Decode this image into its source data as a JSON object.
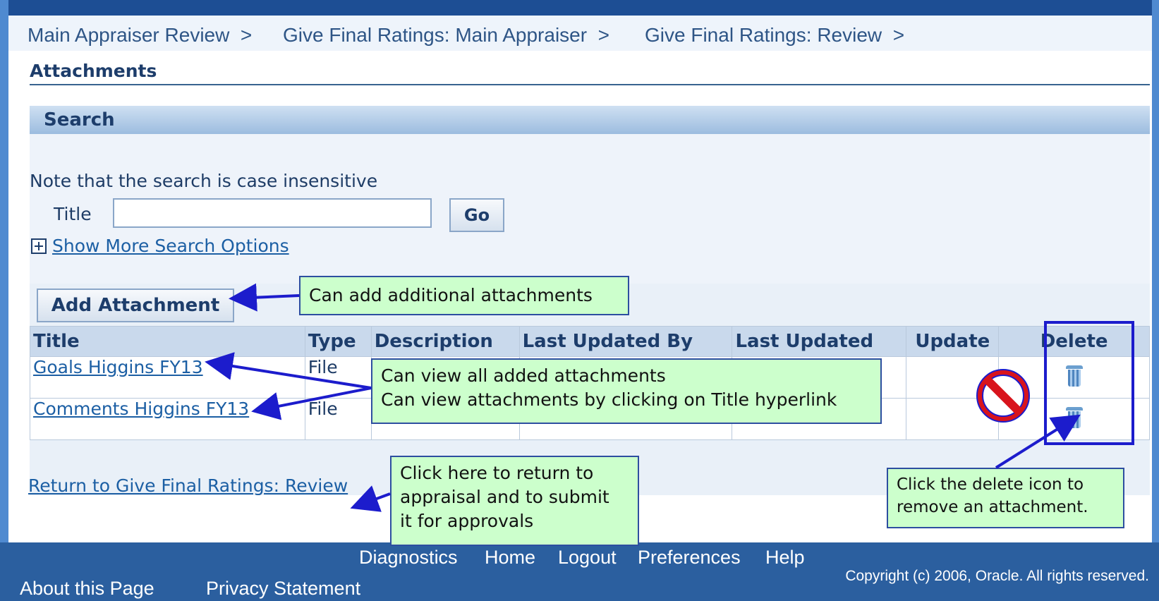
{
  "breadcrumbs": [
    {
      "label": "Main Appraiser Review",
      "sep": ">"
    },
    {
      "label": "Give Final Ratings: Main Appraiser",
      "sep": ">"
    },
    {
      "label": "Give Final Ratings: Review",
      "sep": ">"
    }
  ],
  "page_title": "Attachments",
  "search": {
    "header": "Search",
    "note": "Note that the search is case insensitive",
    "title_label": "Title",
    "title_value": "",
    "go_label": "Go",
    "more_options_label": "Show More Search Options"
  },
  "add_attachment_label": "Add Attachment",
  "table": {
    "columns": [
      "Title",
      "Type",
      "Description",
      "Last Updated By",
      "Last Updated",
      "Update",
      "Delete"
    ],
    "rows": [
      {
        "title": "Goals Higgins FY13",
        "type": "File"
      },
      {
        "title": "Comments Higgins FY13",
        "type": "File"
      }
    ]
  },
  "return_link": "Return to Give Final Ratings: Review",
  "footer": {
    "links_row1": [
      "Diagnostics",
      "Home",
      "Logout",
      "Preferences",
      "Help"
    ],
    "about": "About this Page",
    "privacy": "Privacy Statement",
    "copyright": "Copyright (c) 2006, Oracle. All rights reserved."
  },
  "callouts": {
    "add": "Can add additional attachments",
    "view_line1": "Can view all added attachments",
    "view_line2": "Can  view attachments by clicking on Title hyperlink",
    "return_line1": "Click here to return to",
    "return_line2": "appraisal and to submit",
    "return_line3": "it for approvals",
    "delete_line1": "Click the delete icon to",
    "delete_line2": "remove an attachment."
  },
  "colors": {
    "callout_bg": "#ccffcc",
    "arrow": "#1c1ccc",
    "footer_bg": "#2b5f9f",
    "link": "#1c5fa4"
  },
  "icons": [
    "plus-box-icon",
    "trash-icon",
    "no-entry-icon"
  ]
}
